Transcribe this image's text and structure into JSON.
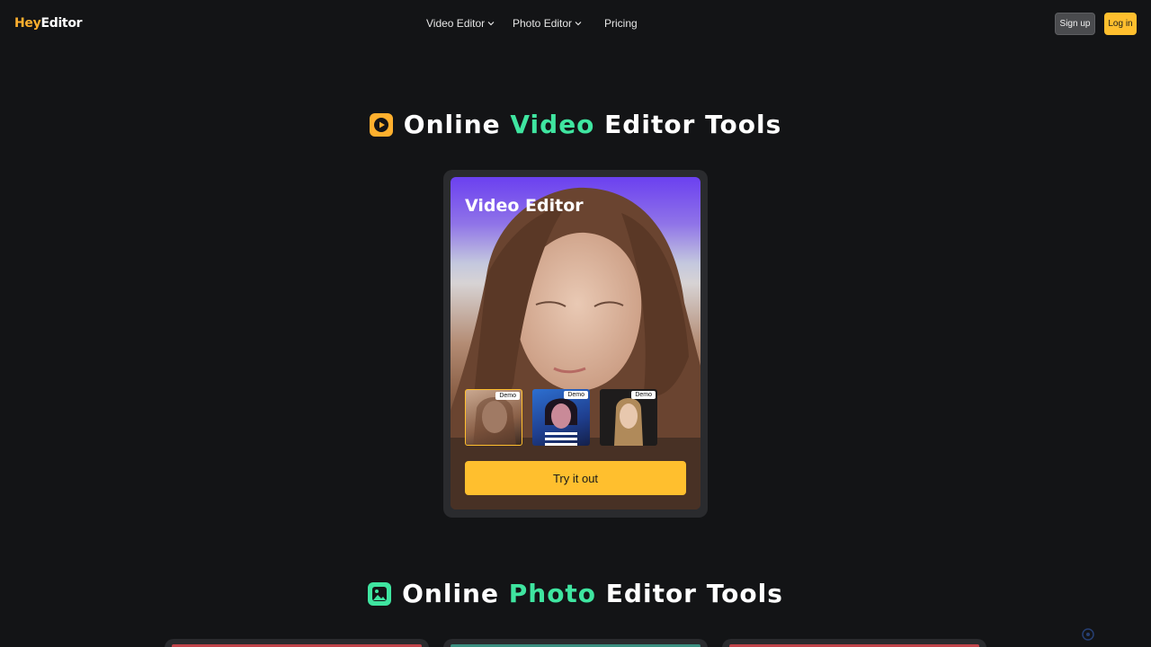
{
  "header": {
    "logo": {
      "hey": "Hey",
      "editor": "Editor"
    },
    "nav": [
      {
        "label": "Video Editor",
        "has_dropdown": true
      },
      {
        "label": "Photo Editor",
        "has_dropdown": true
      },
      {
        "label": "Pricing",
        "has_dropdown": false
      }
    ],
    "signup_label": "Sign up",
    "login_label": "Log in"
  },
  "video_section": {
    "title_pre": "Online ",
    "title_accent": "Video",
    "title_post": " Editor Tools",
    "icon": "play-icon"
  },
  "video_card": {
    "title": "Video Editor",
    "thumbnails": [
      {
        "tag": "Demo",
        "selected": true
      },
      {
        "tag": "Demo",
        "selected": false
      },
      {
        "tag": "Demo",
        "selected": false
      }
    ],
    "cta": "Try it out"
  },
  "photo_section": {
    "title_pre": "Online ",
    "title_accent": "Photo",
    "title_post": " Editor Tools",
    "icon": "image-icon"
  },
  "colors": {
    "background": "#131416",
    "brand_yellow": "#ffbf2e",
    "accent_green": "#3fe5a0",
    "card": "#2a2b2e"
  }
}
